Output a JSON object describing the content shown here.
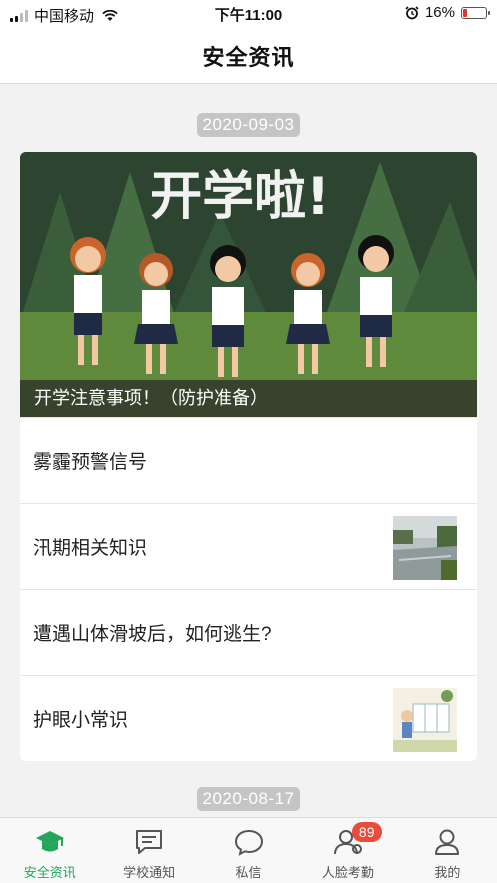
{
  "status_bar": {
    "carrier": "中国移动",
    "time": "下午11:00",
    "battery": "16%",
    "battery_level": 0.16
  },
  "header": {
    "title": "安全资讯"
  },
  "feed": {
    "groups": [
      {
        "date": "2020-09-03",
        "banner": {
          "image_text": "开学啦!",
          "caption": "开学注意事项！（防护准备）"
        },
        "items": [
          {
            "label": "雾霾预警信号",
            "has_thumb": false
          },
          {
            "label": "汛期相关知识",
            "has_thumb": true,
            "thumb": "flood-photo"
          },
          {
            "label": "遭遇山体滑坡后，如何逃生?",
            "has_thumb": false
          },
          {
            "label": "护眼小常识",
            "has_thumb": true,
            "thumb": "eye-care-illustration"
          }
        ]
      },
      {
        "date": "2020-08-17"
      }
    ]
  },
  "tabbar": {
    "tabs": [
      {
        "label": "安全资讯",
        "icon": "graduation-cap-icon",
        "active": true
      },
      {
        "label": "学校通知",
        "icon": "message-lines-icon",
        "active": false
      },
      {
        "label": "私信",
        "icon": "chat-bubble-icon",
        "active": false
      },
      {
        "label": "人脸考勤",
        "icon": "face-attendance-icon",
        "active": false,
        "badge": "89"
      },
      {
        "label": "我的",
        "icon": "person-icon",
        "active": false
      }
    ]
  },
  "colors": {
    "accent": "#23a55a",
    "badge": "#e94b3c",
    "battery_low": "#e0352b"
  }
}
